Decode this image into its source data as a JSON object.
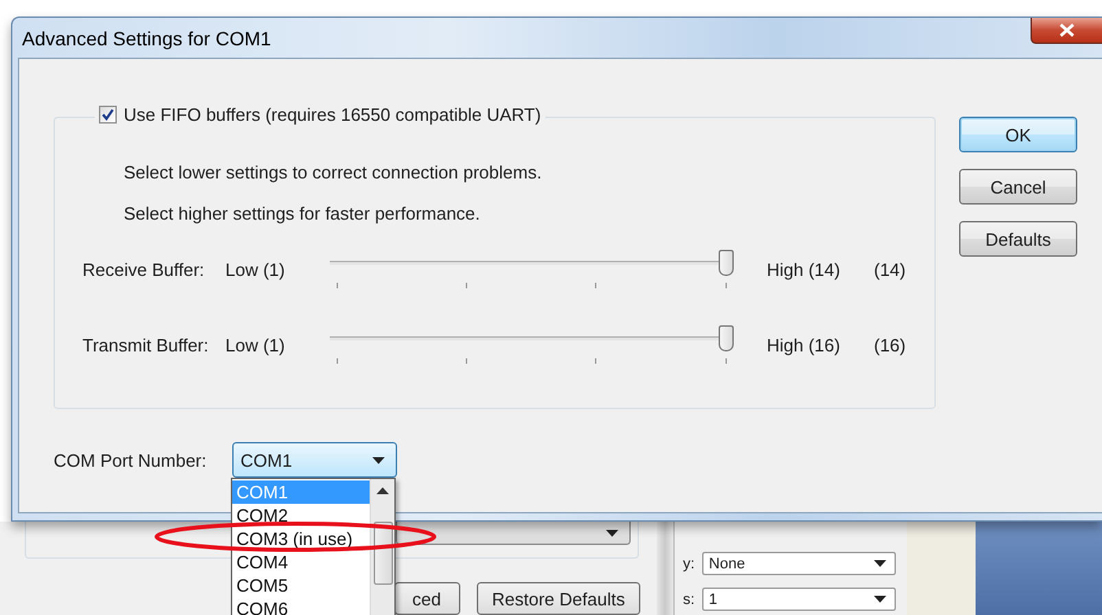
{
  "dialog": {
    "title": "Advanced Settings for COM1",
    "fifo": {
      "label": "Use FIFO buffers (requires 16550 compatible UART)",
      "checked": true
    },
    "hints": [
      "Select lower settings to correct connection problems.",
      "Select higher settings for faster performance."
    ],
    "sliders": [
      {
        "label": "Receive Buffer:",
        "low": "Low (1)",
        "high": "High (14)",
        "reading": "(14)",
        "level": 1
      },
      {
        "label": "Transmit Buffer:",
        "low": "Low (1)",
        "high": "High (16)",
        "reading": "(16)",
        "level": 1
      }
    ],
    "com_port": {
      "label": "COM Port Number:",
      "value": "COM1",
      "expanded": true,
      "options": [
        {
          "label": "COM1",
          "selected": true
        },
        {
          "label": "COM2",
          "selected": false
        },
        {
          "label": "COM3 (in use)",
          "selected": false
        },
        {
          "label": "COM4",
          "selected": false
        },
        {
          "label": "COM5",
          "selected": false
        },
        {
          "label": "COM6",
          "selected": false
        }
      ]
    },
    "buttons": [
      {
        "label": "OK",
        "default": true
      },
      {
        "label": "Cancel",
        "default": false
      },
      {
        "label": "Defaults",
        "default": false
      }
    ]
  },
  "annotation": {
    "kind": "ellipse",
    "color": "#e8101a"
  },
  "background_window": {
    "buttons": [
      "ced",
      "Restore Defaults"
    ],
    "fields": [
      {
        "label": "y:",
        "value": "None"
      },
      {
        "label": "s:",
        "value": "1"
      }
    ]
  }
}
